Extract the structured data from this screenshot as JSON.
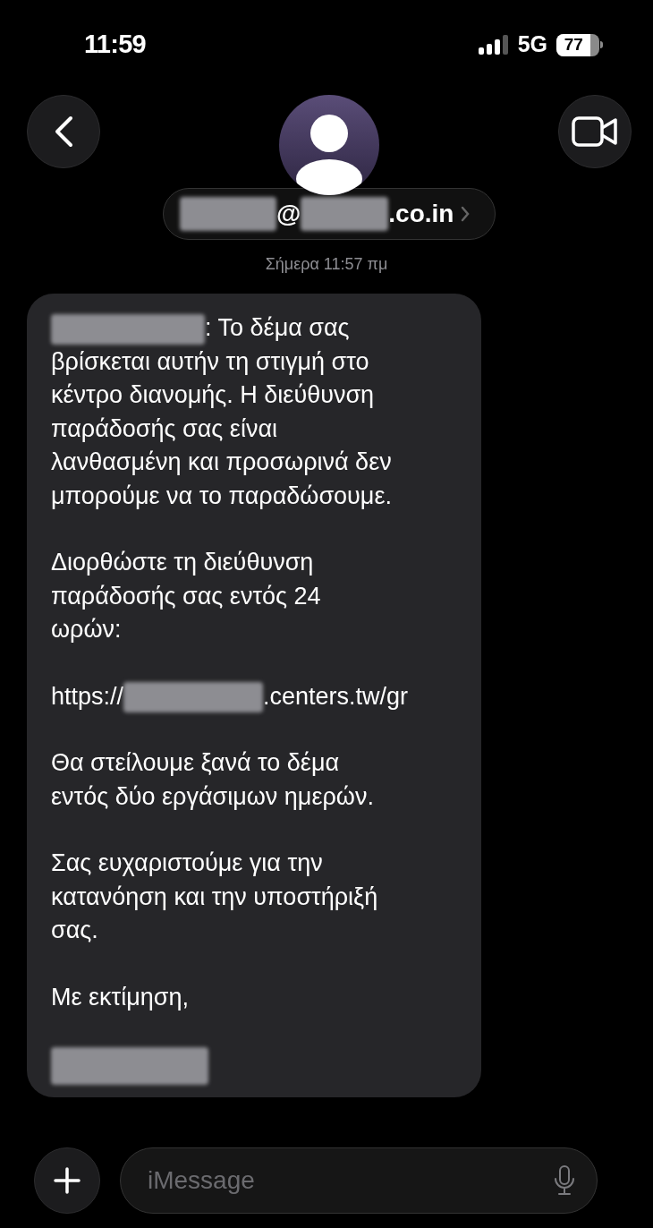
{
  "status_bar": {
    "time": "11:59",
    "network": "5G",
    "battery": "77"
  },
  "header": {
    "contact_segments": [
      {
        "kind": "redacted"
      },
      {
        "kind": "text",
        "text": "@"
      },
      {
        "kind": "redacted"
      },
      {
        "kind": "text",
        "text": ".co.in"
      }
    ]
  },
  "timestamp": "Σήμερα 11:57 πμ",
  "message": {
    "paragraphs": [
      [
        {
          "kind": "redacted"
        },
        {
          "kind": "text",
          "text": ": Το δέμα σας\nβρίσκεται αυτήν τη στιγμή στο\nκέντρο διανομής. Η διεύθυνση\nπαράδοσής σας είναι\nλανθασμένη και προσωρινά δεν\nμπορούμε να το παραδώσουμε."
        }
      ],
      [
        {
          "kind": "text",
          "text": "Διορθώστε τη διεύθυνση\nπαράδοσής σας εντός 24\nωρών:"
        }
      ],
      [
        {
          "kind": "text",
          "text": "https://"
        },
        {
          "kind": "redacted"
        },
        {
          "kind": "text",
          "text": ".centers.tw/gr"
        }
      ],
      [
        {
          "kind": "text",
          "text": "Θα στείλουμε ξανά το δέμα\nεντός δύο εργάσιμων ημερών."
        }
      ],
      [
        {
          "kind": "text",
          "text": "Σας ευχαριστούμε για την\nκατανόηση και την υποστήριξή\nσας."
        }
      ],
      [
        {
          "kind": "text",
          "text": "Με εκτίμηση,"
        }
      ],
      [
        {
          "kind": "redacted"
        }
      ]
    ]
  },
  "composer": {
    "placeholder": "iMessage"
  }
}
